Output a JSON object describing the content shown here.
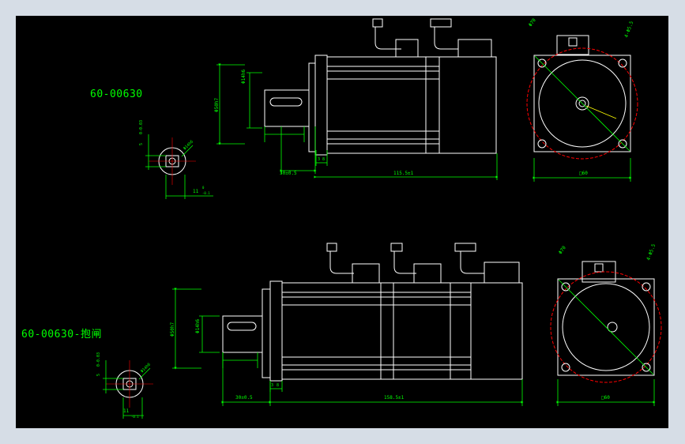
{
  "viewport": {
    "background": "#000000",
    "frame_color": "#d6dde6"
  },
  "colors": {
    "outline": "#ffffff",
    "dimension": "#00ff00",
    "hidden_circle": "#ff0000",
    "centerline": "#ff0000"
  },
  "top_drawing": {
    "part_label": "60-00630",
    "dims": {
      "shaft_len": "30±0.5",
      "body_len": "115.5±1",
      "flange_sq": "□60",
      "bolt_holes": "4-Φ5.5",
      "pcd": "Φ70",
      "shaft_dia": "Φ14h6",
      "pilot_dia": "Φ50h7",
      "flange_gap1": "3",
      "flange_gap2": "8",
      "key_w": "5",
      "keyway_tol": "0-0.03",
      "key_h": "11",
      "key_h_tol_up": "0",
      "key_h_tol_lo": "-0.1",
      "key_depth": "11"
    }
  },
  "bottom_drawing": {
    "part_label": "60-00630-抱闸",
    "dims": {
      "shaft_len": "30±0.5",
      "body_len": "158.5±1",
      "flange_sq": "□60",
      "bolt_holes": "4-Φ5.5",
      "pcd": "Φ70",
      "shaft_dia": "Φ14h6",
      "pilot_dia": "Φ50h7",
      "flange_gap1": "3",
      "flange_gap2": "8",
      "key_w": "5",
      "keyway_tol": "0-0.03",
      "key_h": "11",
      "key_h_tol_lo": "-0.1"
    }
  }
}
